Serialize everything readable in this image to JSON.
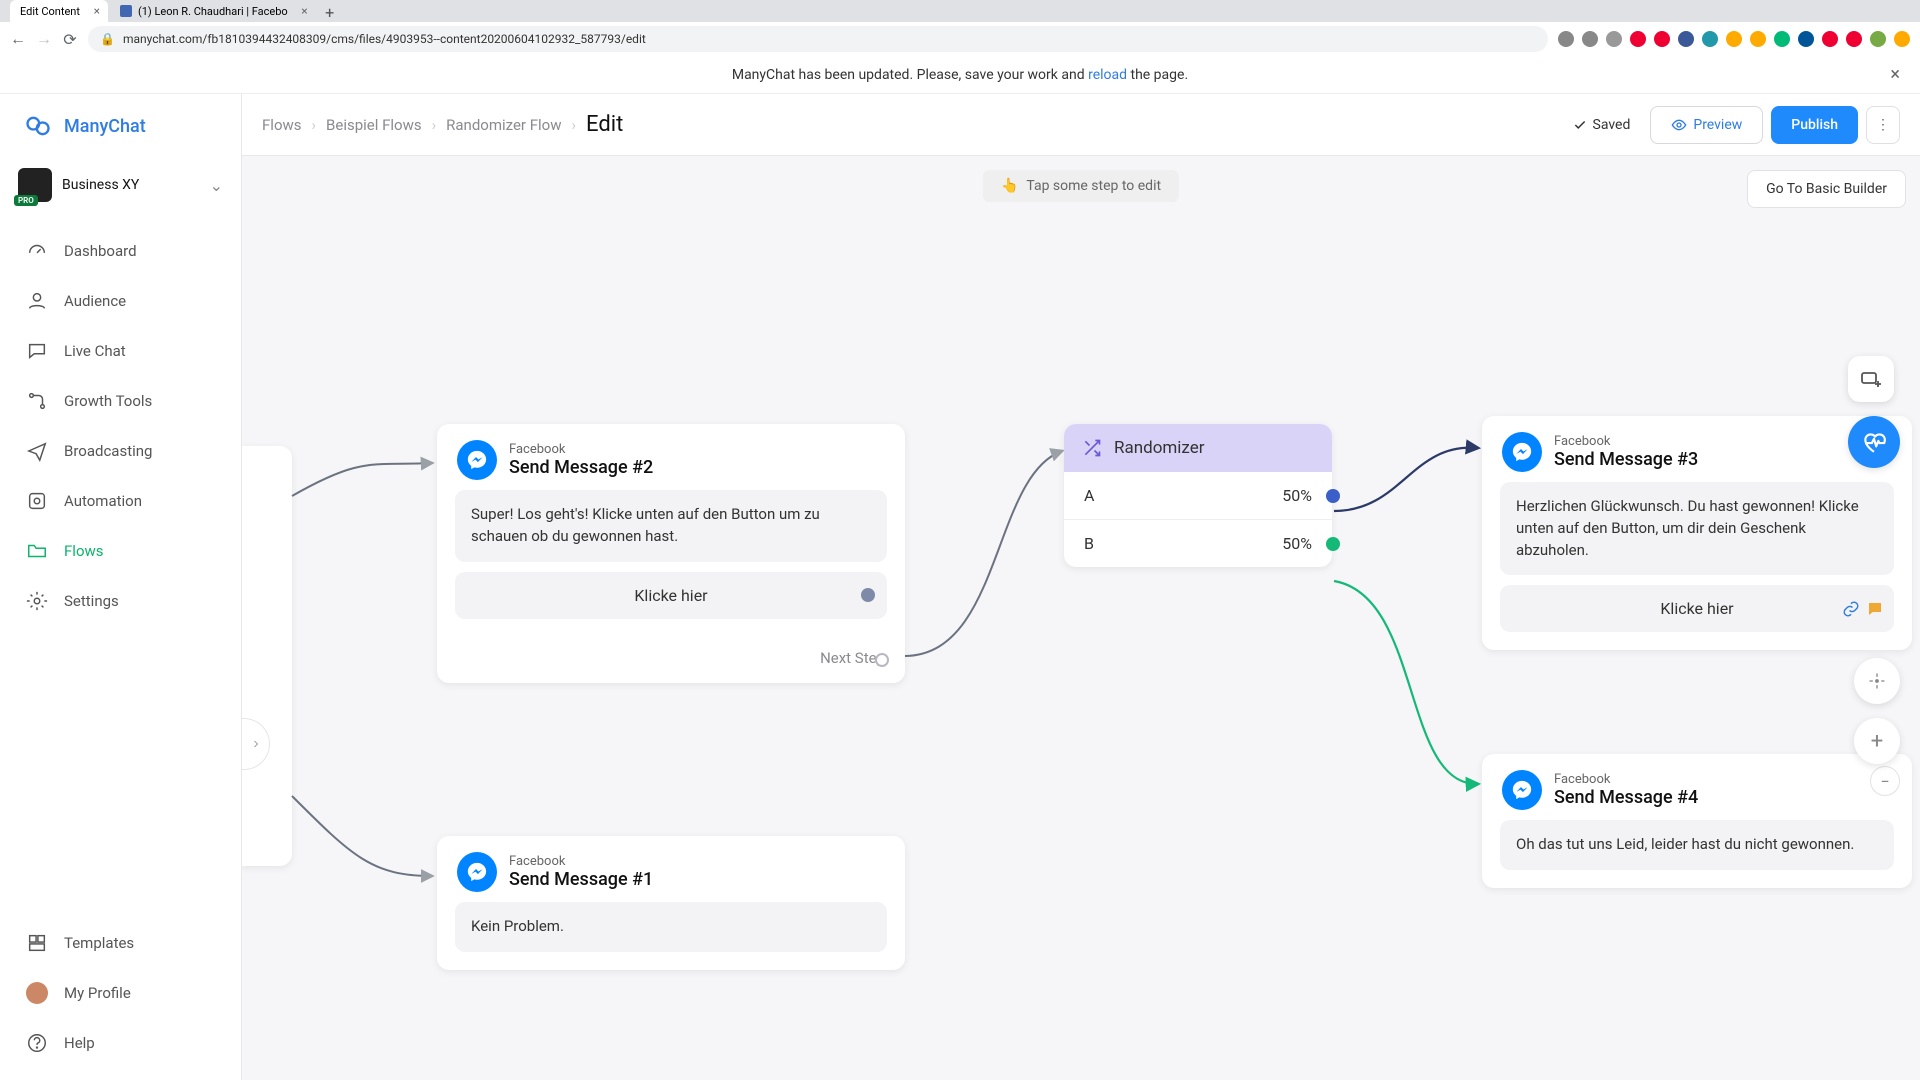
{
  "browser": {
    "tabs": [
      {
        "title": "Edit Content",
        "active": true
      },
      {
        "title": "(1) Leon R. Chaudhari | Facebo",
        "active": false
      }
    ],
    "url": "manychat.com/fb181039443240830​9/cms/files/4903953--content20200604102932_587793/edit"
  },
  "notification": {
    "text_before": "ManyChat has been updated. Please, save your work and ",
    "link": "reload",
    "text_after": " the page."
  },
  "brand": "ManyChat",
  "workspace": {
    "name": "Business XY",
    "badge": "PRO"
  },
  "nav": {
    "dashboard": "Dashboard",
    "audience": "Audience",
    "livechat": "Live Chat",
    "growth": "Growth Tools",
    "broadcasting": "Broadcasting",
    "automation": "Automation",
    "flows": "Flows",
    "settings": "Settings",
    "templates": "Templates",
    "profile": "My Profile",
    "help": "Help"
  },
  "breadcrumbs": {
    "a": "Flows",
    "b": "Beispiel Flows",
    "c": "Randomizer Flow",
    "d": "Edit"
  },
  "topbar": {
    "saved": "Saved",
    "preview": "Preview",
    "publish": "Publish"
  },
  "canvas": {
    "hint": "Tap some step to edit",
    "go_basic": "Go To Basic Builder"
  },
  "nodes": {
    "msg2": {
      "platform": "Facebook",
      "title": "Send Message #2",
      "body": "Super! Los geht's! Klicke unten auf den Button um zu schauen ob du gewonnen hast.",
      "button": "Klicke hier",
      "nextstep": "Next Step"
    },
    "msg1": {
      "platform": "Facebook",
      "title": "Send Message #1",
      "body": "Kein Problem."
    },
    "rand": {
      "title": "Randomizer",
      "a_label": "A",
      "a_pct": "50%",
      "b_label": "B",
      "b_pct": "50%"
    },
    "msg3": {
      "platform": "Facebook",
      "title": "Send Message #3",
      "body": "Herzlichen Glückwunsch. Du hast gewonnen! Klicke unten auf den Button, um dir dein Geschenk abzuholen.",
      "button": "Klicke hier"
    },
    "msg4": {
      "platform": "Facebook",
      "title": "Send Message #4",
      "body": "Oh das tut uns Leid, leider hast du nicht gewonnen."
    }
  }
}
